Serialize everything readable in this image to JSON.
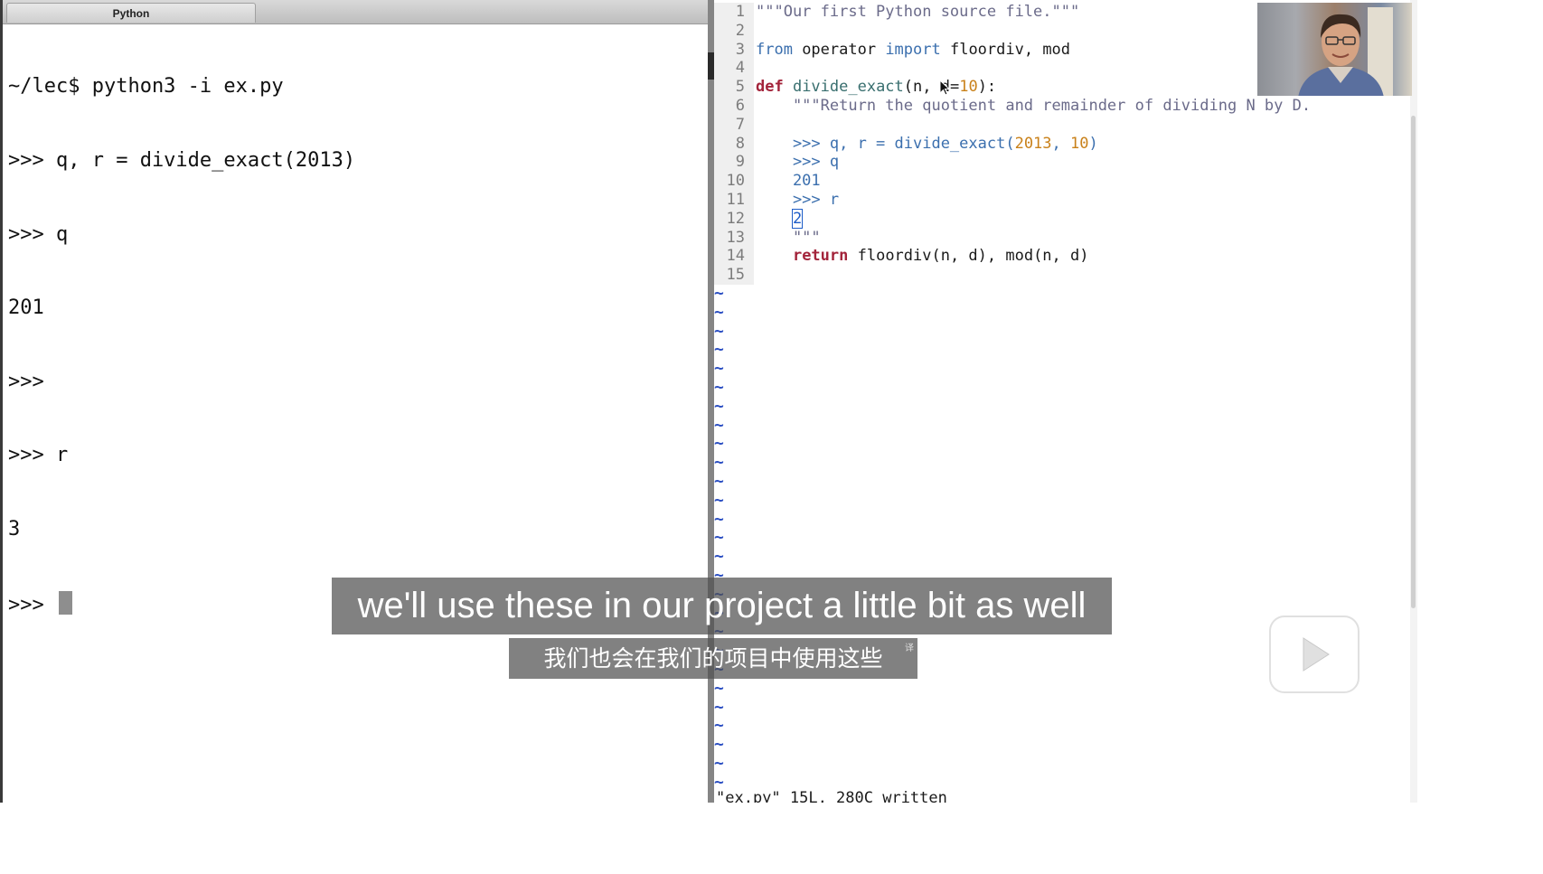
{
  "terminal": {
    "tab_title": "Python",
    "lines": [
      "~/lec$ python3 -i ex.py",
      ">>> q, r = divide_exact(2013)",
      ">>> q",
      "201",
      ">>>",
      ">>> r",
      "3"
    ],
    "prompt": ">>> "
  },
  "editor": {
    "line_numbers": [
      "1",
      "2",
      "3",
      "4",
      "5",
      "6",
      "7",
      "8",
      "9",
      "10",
      "11",
      "12",
      "13",
      "14",
      "15"
    ],
    "tokens": {
      "l1": "\"\"\"Our first Python source file.\"\"\"",
      "l3_from": "from",
      "l3_mod": " operator ",
      "l3_import": "import",
      "l3_names": " floordiv, mod",
      "l5_def": "def",
      "l5_fn": " divide_exact",
      "l5_args": "(n, d=",
      "l5_num": "10",
      "l5_end": "):",
      "l6": "    \"\"\"Return the quotient and remainder of dividing N by D.",
      "l8_a": "    >>> q, r = divide_exact(",
      "l8_n1": "2013",
      "l8_b": ", ",
      "l8_n2": "10",
      "l8_c": ")",
      "l9": "    >>> q",
      "l10": "    201",
      "l11": "    >>> r",
      "l12_indent": "    ",
      "l12_cursor": "2",
      "l13": "    \"\"\"",
      "l14_indent": "    ",
      "l14_return": "return",
      "l14_rest": " floordiv(n, d), mod(n, d)"
    },
    "empty_line_marker": "~",
    "status_message": "\"ex.py\" 15L, 280C written"
  },
  "subtitles": {
    "english": "we'll use these in our project a little bit as well",
    "chinese": "我们也会在我们的项目中使用这些",
    "translate_mark": "译"
  },
  "icons": {
    "player_logo": "tv-play-icon",
    "mouse": "mouse-pointer-icon",
    "webcam": "webcam-presenter"
  },
  "colors": {
    "keyword_blue": "#3b6fae",
    "keyword_red": "#a3243b",
    "number_orange": "#c9811a",
    "tilde_blue": "#2a4ec2",
    "subtitle_bg": "#505050"
  }
}
